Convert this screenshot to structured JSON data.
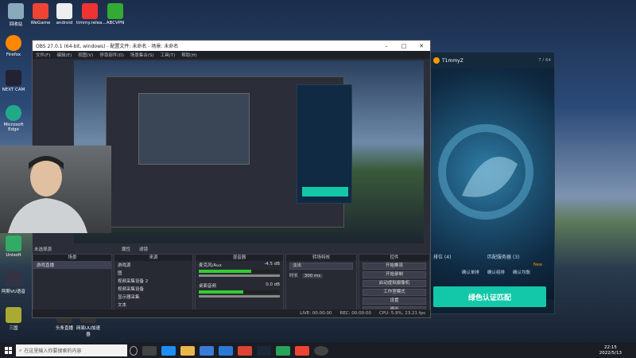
{
  "desktop": {
    "icons": [
      {
        "label": "回收站",
        "color": "#8ab"
      },
      {
        "label": "WeGame",
        "color": "#e43"
      },
      {
        "label": "android",
        "color": "#eee"
      },
      {
        "label": "timmy.relea...",
        "color": "#e33"
      },
      {
        "label": "ABCVPN",
        "color": "#3a3"
      },
      {
        "label": "Firefox",
        "color": "#f80"
      },
      {
        "label": "NEXT CAM",
        "color": "#223"
      },
      {
        "label": "Microsoft Edge",
        "color": "#2a8"
      },
      {
        "label": "Unisoft",
        "color": "#3a6"
      },
      {
        "label": "阿斯VU语音",
        "color": "#334"
      },
      {
        "label": "三国",
        "color": "#aa3"
      },
      {
        "label": "头条直播",
        "color": "#333"
      },
      {
        "label": "网易UU加速器",
        "color": "#333"
      }
    ]
  },
  "obs": {
    "title": "OBS 27.0.1 (64-bit, windows) - 配置文件: 未命名 - 场景: 未命名",
    "menu": [
      "文件(F)",
      "编辑(E)",
      "视图(V)",
      "停靠部件(D)",
      "场景集合(S)",
      "工具(T)",
      "帮助(H)"
    ],
    "no_source_label": "未选择源",
    "props_label": "属性",
    "filters_label": "滤镜",
    "scenes_header": "场景",
    "scenes": [
      "游戏直播"
    ],
    "sources_header": "来源",
    "sources": [
      "游戏源",
      "图",
      "视频采集设备 2",
      "视频采集设备",
      "显示器采集",
      "文本"
    ],
    "mixer_header": "混音器",
    "mixer": [
      {
        "name": "麦克风/Aux",
        "db": "-4.5 dB",
        "level": 0.65
      },
      {
        "name": "桌面音频",
        "db": "0.0 dB",
        "level": 0.55
      }
    ],
    "transitions_header": "转场特效",
    "transition": "淡出",
    "duration_label": "时长",
    "duration": "300 ms",
    "controls_header": "控件",
    "controls": [
      "开始推流",
      "开始录制",
      "启动虚拟摄像机",
      "工作室模式",
      "设置",
      "退出"
    ],
    "status": {
      "live": "LIVE: 00:00:00",
      "rec": "REC: 00:00:00",
      "cpu": "CPU: 5.9%, 23.21 fps"
    }
  },
  "game": {
    "username": "T1mmyZ",
    "counter": "7 / 64",
    "queue_left": "排位 (4)",
    "queue_right": "匹配服务器 (3)",
    "options": [
      "确认单排",
      "确认组排",
      "确认均衡"
    ],
    "new_badge": "New",
    "match_button": "绿色认证匹配"
  },
  "taskbar": {
    "search_placeholder": "在这里输入你要搜索的内容",
    "time": "22:15",
    "date": "2022/5/13"
  },
  "colors": {
    "accent": "#13c8a8",
    "obs_bg": "#2b2e38",
    "taskbar": "#1a1d24"
  }
}
